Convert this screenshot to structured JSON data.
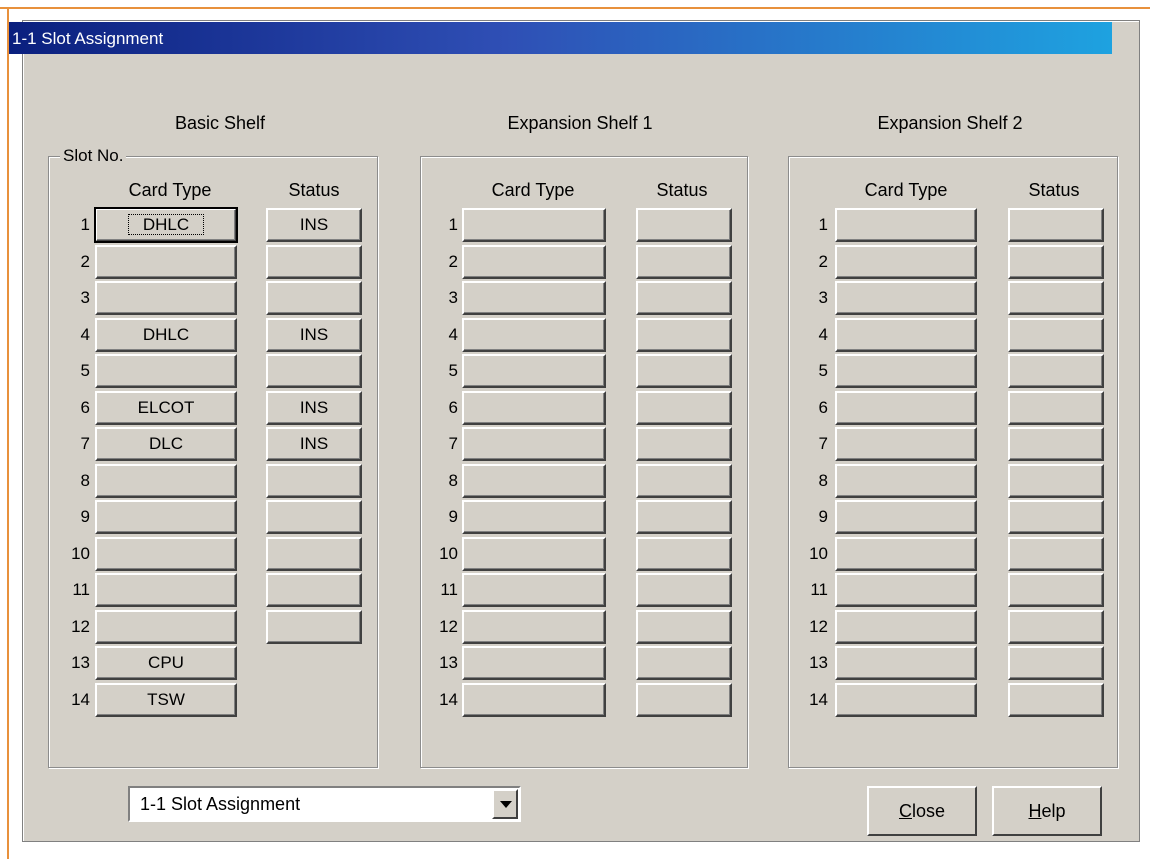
{
  "window": {
    "title": "1-1 Slot Assignment"
  },
  "slot_no_label": "Slot No.",
  "columns": {
    "card_type": "Card Type",
    "status": "Status"
  },
  "shelves": [
    {
      "title": "Basic Shelf",
      "slots": [
        {
          "no": "1",
          "card": "DHLC",
          "status": "INS"
        },
        {
          "no": "2",
          "card": "",
          "status": ""
        },
        {
          "no": "3",
          "card": "",
          "status": ""
        },
        {
          "no": "4",
          "card": "DHLC",
          "status": "INS"
        },
        {
          "no": "5",
          "card": "",
          "status": ""
        },
        {
          "no": "6",
          "card": "ELCOT",
          "status": "INS"
        },
        {
          "no": "7",
          "card": "DLC",
          "status": "INS"
        },
        {
          "no": "8",
          "card": "",
          "status": ""
        },
        {
          "no": "9",
          "card": "",
          "status": ""
        },
        {
          "no": "10",
          "card": "",
          "status": ""
        },
        {
          "no": "11",
          "card": "",
          "status": ""
        },
        {
          "no": "12",
          "card": "",
          "status": ""
        },
        {
          "no": "13",
          "card": "CPU",
          "status": null
        },
        {
          "no": "14",
          "card": "TSW",
          "status": null
        }
      ]
    },
    {
      "title": "Expansion Shelf 1",
      "slots": [
        {
          "no": "1",
          "card": "",
          "status": ""
        },
        {
          "no": "2",
          "card": "",
          "status": ""
        },
        {
          "no": "3",
          "card": "",
          "status": ""
        },
        {
          "no": "4",
          "card": "",
          "status": ""
        },
        {
          "no": "5",
          "card": "",
          "status": ""
        },
        {
          "no": "6",
          "card": "",
          "status": ""
        },
        {
          "no": "7",
          "card": "",
          "status": ""
        },
        {
          "no": "8",
          "card": "",
          "status": ""
        },
        {
          "no": "9",
          "card": "",
          "status": ""
        },
        {
          "no": "10",
          "card": "",
          "status": ""
        },
        {
          "no": "11",
          "card": "",
          "status": ""
        },
        {
          "no": "12",
          "card": "",
          "status": ""
        },
        {
          "no": "13",
          "card": "",
          "status": ""
        },
        {
          "no": "14",
          "card": "",
          "status": ""
        }
      ]
    },
    {
      "title": "Expansion Shelf 2",
      "slots": [
        {
          "no": "1",
          "card": "",
          "status": ""
        },
        {
          "no": "2",
          "card": "",
          "status": ""
        },
        {
          "no": "3",
          "card": "",
          "status": ""
        },
        {
          "no": "4",
          "card": "",
          "status": ""
        },
        {
          "no": "5",
          "card": "",
          "status": ""
        },
        {
          "no": "6",
          "card": "",
          "status": ""
        },
        {
          "no": "7",
          "card": "",
          "status": ""
        },
        {
          "no": "8",
          "card": "",
          "status": ""
        },
        {
          "no": "9",
          "card": "",
          "status": ""
        },
        {
          "no": "10",
          "card": "",
          "status": ""
        },
        {
          "no": "11",
          "card": "",
          "status": ""
        },
        {
          "no": "12",
          "card": "",
          "status": ""
        },
        {
          "no": "13",
          "card": "",
          "status": ""
        },
        {
          "no": "14",
          "card": "",
          "status": ""
        }
      ]
    }
  ],
  "footer": {
    "combo_value": "1-1 Slot Assignment",
    "close_mnemonic": "C",
    "close_rest": "lose",
    "help_mnemonic": "H",
    "help_rest": "elp"
  },
  "colors": {
    "title_start": "#0a1f7e",
    "title_end": "#1ea2e0",
    "face": "#d4d0c8",
    "frame_accent": "#e8913c"
  }
}
